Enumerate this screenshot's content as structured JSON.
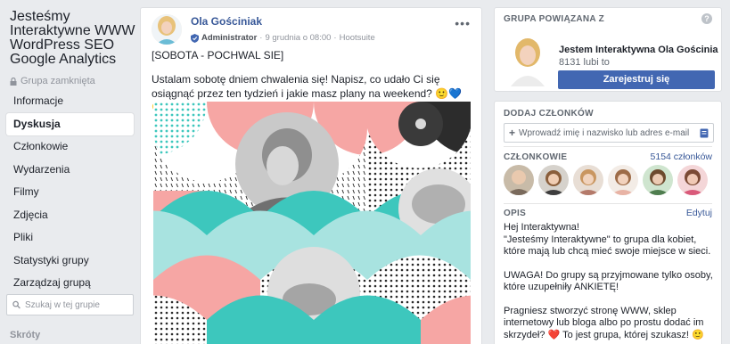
{
  "sidebar": {
    "group_title": "Jesteśmy Interaktywne WWW WordPress SEO Google Analytics",
    "group_type": "Grupa zamknięta",
    "nav": [
      {
        "label": "Informacje",
        "active": false
      },
      {
        "label": "Dyskusja",
        "active": true
      },
      {
        "label": "Członkowie",
        "active": false
      },
      {
        "label": "Wydarzenia",
        "active": false
      },
      {
        "label": "Filmy",
        "active": false
      },
      {
        "label": "Zdjęcia",
        "active": false
      },
      {
        "label": "Pliki",
        "active": false
      },
      {
        "label": "Statystyki grupy",
        "active": false
      },
      {
        "label": "Zarządzaj grupą",
        "active": false
      }
    ],
    "search_placeholder": "Szukaj w tej grupie",
    "shortcuts_label": "Skróty"
  },
  "post": {
    "author": "Ola Gościniak",
    "role": "Administrator",
    "separator": "·",
    "date": "9 grudnia o 08:00",
    "via": "Hootsuite",
    "line1": "[SOBOTA - POCHWAL SIE]",
    "line2": "Ustalam sobotę dniem chwalenia się! Napisz, co udało Ci się osiągnąć przez ten tydzień i jakie masz plany na weekend? 🙂💙💛",
    "more_icon": "more-dots-icon"
  },
  "related": {
    "heading": "GRUPA POWIĄZANA Z",
    "help_glyph": "?",
    "name": "Jestem Interaktywna Ola Gościnia",
    "likes": "8131 lubi to",
    "join_label": "Zarejestruj się"
  },
  "members": {
    "add_heading": "DODAJ CZŁONKÓW",
    "add_placeholder": "Wprowadź imię i nazwisko lub adres e-mail",
    "members_heading": "CZŁONKOWIE",
    "member_count": "5154 członków",
    "desc_heading": "OPIS",
    "edit_label": "Edytuj",
    "desc_p1": "Hej Interaktywna!\n\"Jesteśmy Interaktywne\" to grupa dla kobiet, które mają lub chcą mieć swoje miejsce w sieci.",
    "desc_p2": "UWAGA! Do grupy są przyjmowane tylko osoby, które uzupełniły ANKIETĘ!",
    "desc_p3": "Pragniesz stworzyć stronę WWW, sklep internetowy lub bloga albo po prostu dodać im skrzydeł? ❤️ To jest grupa, której szukasz! 🙂"
  },
  "colors": {
    "facebook_blue": "#4267b2",
    "link_blue": "#385898",
    "pattern_coral": "#f6a6a4",
    "pattern_teal": "#3dc7bd",
    "pattern_light_teal": "#a8e3e0"
  }
}
